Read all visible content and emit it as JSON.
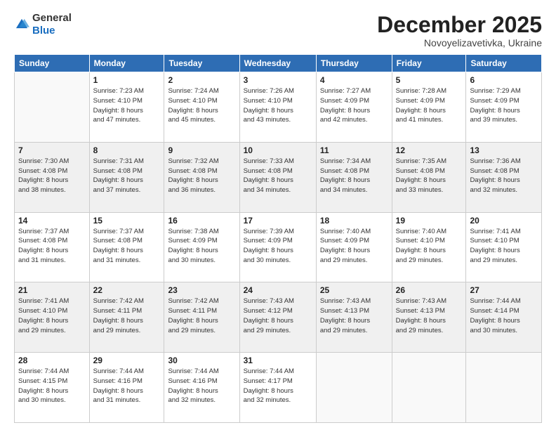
{
  "logo": {
    "general": "General",
    "blue": "Blue"
  },
  "header": {
    "month": "December 2025",
    "location": "Novoyelizavetivka, Ukraine"
  },
  "weekdays": [
    "Sunday",
    "Monday",
    "Tuesday",
    "Wednesday",
    "Thursday",
    "Friday",
    "Saturday"
  ],
  "weeks": [
    [
      {
        "day": "",
        "info": ""
      },
      {
        "day": "1",
        "info": "Sunrise: 7:23 AM\nSunset: 4:10 PM\nDaylight: 8 hours\nand 47 minutes."
      },
      {
        "day": "2",
        "info": "Sunrise: 7:24 AM\nSunset: 4:10 PM\nDaylight: 8 hours\nand 45 minutes."
      },
      {
        "day": "3",
        "info": "Sunrise: 7:26 AM\nSunset: 4:10 PM\nDaylight: 8 hours\nand 43 minutes."
      },
      {
        "day": "4",
        "info": "Sunrise: 7:27 AM\nSunset: 4:09 PM\nDaylight: 8 hours\nand 42 minutes."
      },
      {
        "day": "5",
        "info": "Sunrise: 7:28 AM\nSunset: 4:09 PM\nDaylight: 8 hours\nand 41 minutes."
      },
      {
        "day": "6",
        "info": "Sunrise: 7:29 AM\nSunset: 4:09 PM\nDaylight: 8 hours\nand 39 minutes."
      }
    ],
    [
      {
        "day": "7",
        "info": "Sunrise: 7:30 AM\nSunset: 4:08 PM\nDaylight: 8 hours\nand 38 minutes."
      },
      {
        "day": "8",
        "info": "Sunrise: 7:31 AM\nSunset: 4:08 PM\nDaylight: 8 hours\nand 37 minutes."
      },
      {
        "day": "9",
        "info": "Sunrise: 7:32 AM\nSunset: 4:08 PM\nDaylight: 8 hours\nand 36 minutes."
      },
      {
        "day": "10",
        "info": "Sunrise: 7:33 AM\nSunset: 4:08 PM\nDaylight: 8 hours\nand 34 minutes."
      },
      {
        "day": "11",
        "info": "Sunrise: 7:34 AM\nSunset: 4:08 PM\nDaylight: 8 hours\nand 34 minutes."
      },
      {
        "day": "12",
        "info": "Sunrise: 7:35 AM\nSunset: 4:08 PM\nDaylight: 8 hours\nand 33 minutes."
      },
      {
        "day": "13",
        "info": "Sunrise: 7:36 AM\nSunset: 4:08 PM\nDaylight: 8 hours\nand 32 minutes."
      }
    ],
    [
      {
        "day": "14",
        "info": "Sunrise: 7:37 AM\nSunset: 4:08 PM\nDaylight: 8 hours\nand 31 minutes."
      },
      {
        "day": "15",
        "info": "Sunrise: 7:37 AM\nSunset: 4:08 PM\nDaylight: 8 hours\nand 31 minutes."
      },
      {
        "day": "16",
        "info": "Sunrise: 7:38 AM\nSunset: 4:09 PM\nDaylight: 8 hours\nand 30 minutes."
      },
      {
        "day": "17",
        "info": "Sunrise: 7:39 AM\nSunset: 4:09 PM\nDaylight: 8 hours\nand 30 minutes."
      },
      {
        "day": "18",
        "info": "Sunrise: 7:40 AM\nSunset: 4:09 PM\nDaylight: 8 hours\nand 29 minutes."
      },
      {
        "day": "19",
        "info": "Sunrise: 7:40 AM\nSunset: 4:10 PM\nDaylight: 8 hours\nand 29 minutes."
      },
      {
        "day": "20",
        "info": "Sunrise: 7:41 AM\nSunset: 4:10 PM\nDaylight: 8 hours\nand 29 minutes."
      }
    ],
    [
      {
        "day": "21",
        "info": "Sunrise: 7:41 AM\nSunset: 4:10 PM\nDaylight: 8 hours\nand 29 minutes."
      },
      {
        "day": "22",
        "info": "Sunrise: 7:42 AM\nSunset: 4:11 PM\nDaylight: 8 hours\nand 29 minutes."
      },
      {
        "day": "23",
        "info": "Sunrise: 7:42 AM\nSunset: 4:11 PM\nDaylight: 8 hours\nand 29 minutes."
      },
      {
        "day": "24",
        "info": "Sunrise: 7:43 AM\nSunset: 4:12 PM\nDaylight: 8 hours\nand 29 minutes."
      },
      {
        "day": "25",
        "info": "Sunrise: 7:43 AM\nSunset: 4:13 PM\nDaylight: 8 hours\nand 29 minutes."
      },
      {
        "day": "26",
        "info": "Sunrise: 7:43 AM\nSunset: 4:13 PM\nDaylight: 8 hours\nand 29 minutes."
      },
      {
        "day": "27",
        "info": "Sunrise: 7:44 AM\nSunset: 4:14 PM\nDaylight: 8 hours\nand 30 minutes."
      }
    ],
    [
      {
        "day": "28",
        "info": "Sunrise: 7:44 AM\nSunset: 4:15 PM\nDaylight: 8 hours\nand 30 minutes."
      },
      {
        "day": "29",
        "info": "Sunrise: 7:44 AM\nSunset: 4:16 PM\nDaylight: 8 hours\nand 31 minutes."
      },
      {
        "day": "30",
        "info": "Sunrise: 7:44 AM\nSunset: 4:16 PM\nDaylight: 8 hours\nand 32 minutes."
      },
      {
        "day": "31",
        "info": "Sunrise: 7:44 AM\nSunset: 4:17 PM\nDaylight: 8 hours\nand 32 minutes."
      },
      {
        "day": "",
        "info": ""
      },
      {
        "day": "",
        "info": ""
      },
      {
        "day": "",
        "info": ""
      }
    ]
  ]
}
